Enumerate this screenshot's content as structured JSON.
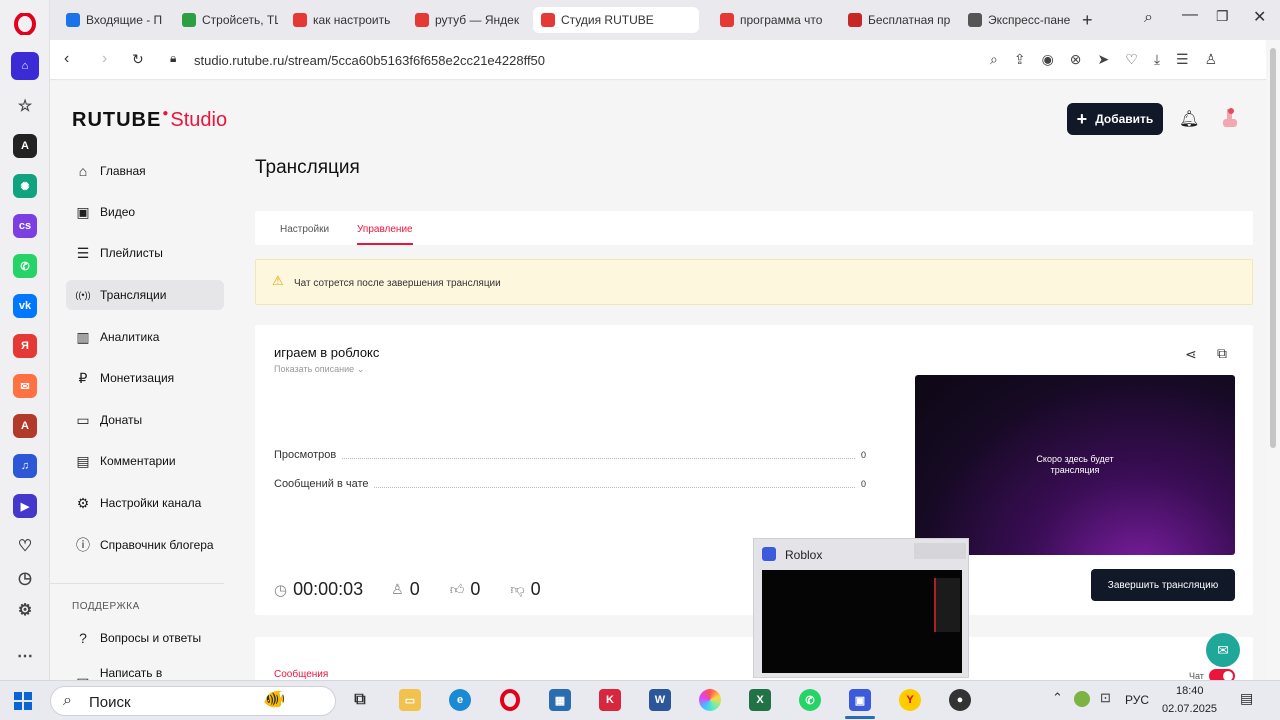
{
  "tabs": [
    {
      "label": "Входящие - По",
      "color": "#1a73e8"
    },
    {
      "label": "Стройсеть, ТЦ",
      "color": "#2e9e44"
    },
    {
      "label": "как настроить",
      "color": "#e53935"
    },
    {
      "label": "рутуб — Яндек",
      "color": "#e53935"
    },
    {
      "label": "Студия RUTUBE",
      "color": "#e53935"
    },
    {
      "label": "программа что",
      "color": "#e53935"
    },
    {
      "label": "Бесплатная пр",
      "color": "#c62828"
    },
    {
      "label": "Экспресс-пане",
      "color": "#555555"
    }
  ],
  "address": {
    "url": "studio.rutube.ru/stream/5cca60b5163f6f658e2cc21e4228ff50"
  },
  "brand": {
    "main": "RUTUBE",
    "sub": "Studio",
    "accent": "#ed143b"
  },
  "header": {
    "add_label": "Добавить"
  },
  "sidebar": {
    "items": [
      {
        "label": "Главная",
        "icon": "home-icon"
      },
      {
        "label": "Видео",
        "icon": "video-icon"
      },
      {
        "label": "Плейлисты",
        "icon": "playlist-icon"
      },
      {
        "label": "Трансляции",
        "icon": "broadcast-icon"
      },
      {
        "label": "Аналитика",
        "icon": "analytics-icon"
      },
      {
        "label": "Монетизация",
        "icon": "ruble-icon"
      },
      {
        "label": "Донаты",
        "icon": "wallet-icon"
      },
      {
        "label": "Комментарии",
        "icon": "comment-icon"
      },
      {
        "label": "Настройки канала",
        "icon": "gear-icon"
      },
      {
        "label": "Справочник блогера",
        "icon": "info-icon"
      }
    ],
    "support_heading": "ПОДДЕРЖКА",
    "support_items": [
      {
        "label": "Вопросы и ответы"
      },
      {
        "label": "Написать в поддержку"
      }
    ]
  },
  "main": {
    "title": "Трансляция",
    "tabs": [
      {
        "label": "Настройки"
      },
      {
        "label": "Управление"
      }
    ],
    "alert": "Чат сотрется после завершения трансляции",
    "stream": {
      "name": "играем в роблокс",
      "show_desc": "Показать описание",
      "stats": [
        {
          "label": "Просмотров",
          "value": "0"
        },
        {
          "label": "Сообщений в чате",
          "value": "0"
        }
      ],
      "timer": "00:00:03",
      "viewers": "0",
      "likes": "0",
      "dislikes": "0",
      "preview_text": "Скоро здесь будет трансляция",
      "end_button": "Завершить трансляцию"
    },
    "messages_label": "Сообщения",
    "chat_label": "Чат"
  },
  "popup": {
    "title": "Roblox"
  },
  "taskbar": {
    "search": "Поиск",
    "lang": "РУС",
    "time": "18:40",
    "date": "02.07.2025"
  }
}
